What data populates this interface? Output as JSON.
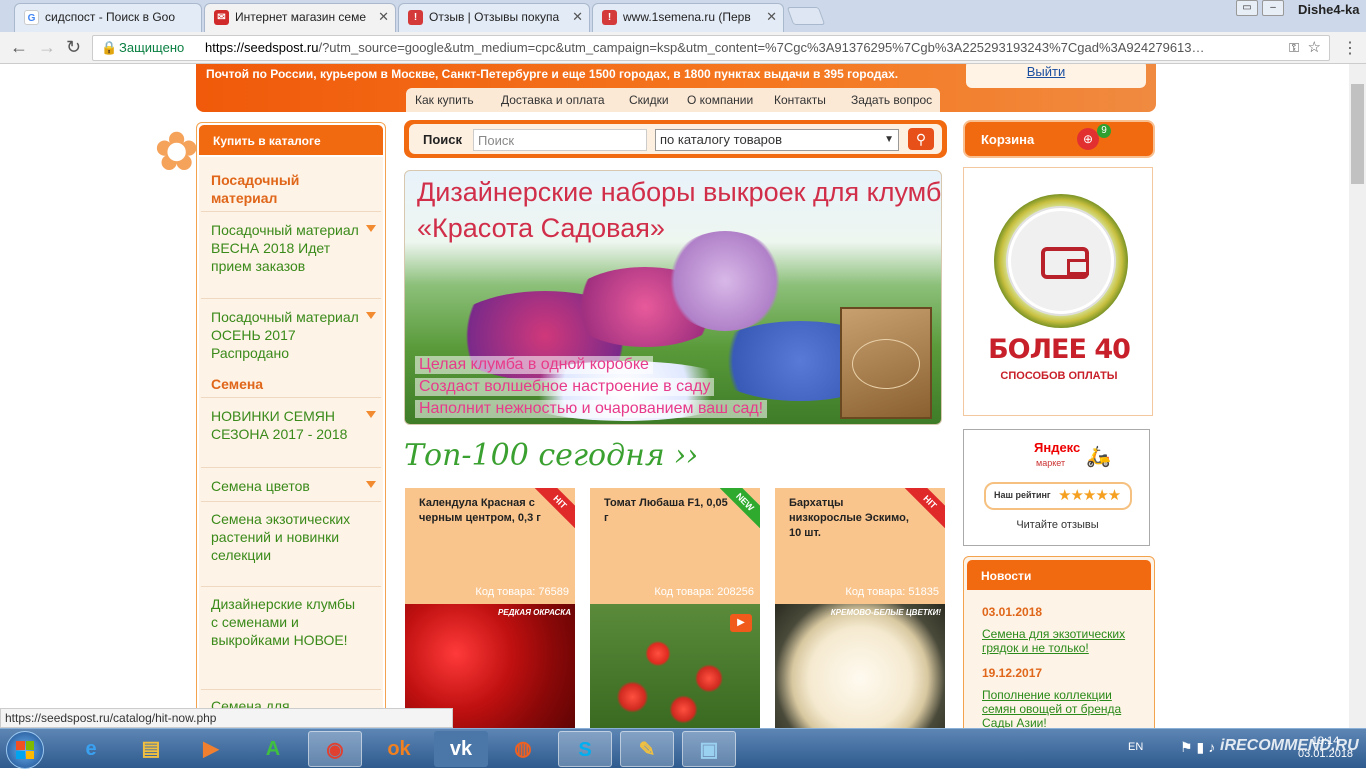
{
  "browser": {
    "tabs": [
      {
        "label": "сидспост - Поиск в Goo",
        "fav_color": "#4285f4",
        "fav": "G"
      },
      {
        "label": "Интернет магазин семе",
        "fav_color": "#d02a2a",
        "fav": "✉"
      },
      {
        "label": "Отзыв | Отзывы покупа",
        "fav_color": "#d43a3a",
        "fav": "!"
      },
      {
        "label": "www.1semena.ru (Перв",
        "fav_color": "#d43a3a",
        "fav": "!"
      }
    ],
    "profile": "Dishe4-ka",
    "secure_label": "Защищено",
    "url_host": "https://seedspost.ru",
    "url_rest": "/?utm_source=google&utm_medium=cpc&utm_campaign=ksp&utm_content=%7Cgc%3A91376295%7Cgb%3A225293193243%7Cgad%3A924279613…",
    "status_url": "https://seedspost.ru/catalog/hit-now.php"
  },
  "site": {
    "delivery_text": "Почтой по России, курьером в Москве, Санкт-Петербурге и еще 1500 городах, в 1800 пунктах выдачи в 395 городах.",
    "logout": "Выйти",
    "nav": [
      "Как купить",
      "Доставка и оплата",
      "Скидки",
      "О компании",
      "Контакты",
      "Задать вопрос"
    ],
    "sidebar": {
      "header": "Купить в каталоге",
      "section1": "Посадочный материал",
      "items1": [
        "Посадочный материал ВЕСНА 2018 Идет прием заказов",
        "Посадочный материал ОСЕНЬ 2017 Распродано"
      ],
      "section2": "Семена",
      "items2": [
        "НОВИНКИ СЕМЯН СЕЗОНА 2017 - 2018",
        "Семена цветов",
        "Семена экзотических растений и новинки селекции",
        "Дизайнерские клумбы с семенами и выкройками НОВОЕ!",
        "Семена для"
      ]
    },
    "search": {
      "label": "Поиск",
      "placeholder": "Поиск",
      "scope": "по каталогу товаров"
    },
    "banner": {
      "title1": "Дизайнерские наборы выкроек для клумб",
      "title2": "«Красота Садовая»",
      "taglines": [
        "Целая клумба в одной коробке",
        "Создаст волшебное настроение в саду",
        "Наполнит нежностью и очарованием ваш сад!"
      ]
    },
    "top100": "Топ-100 сегодня ››",
    "products": [
      {
        "title": "Календула Красная с черным центром, 0,3 г",
        "code": "Код товара: 76589",
        "badge": "HIT",
        "badge_color": "#e02a2a",
        "caption": "РЕДКАЯ ОКРАСКА"
      },
      {
        "title": "Томат Любаша F1, 0,05 г",
        "code": "Код товара: 208256",
        "badge": "NEW",
        "badge_color": "#2faa2f",
        "caption": ""
      },
      {
        "title": "Бархатцы низкорослые Эскимо, 10 шт.",
        "code": "Код товара: 51835",
        "badge": "HIT",
        "badge_color": "#e02a2a",
        "caption": "КРЕМОВО-БЕЛЫЕ ЦВЕТКИ!"
      }
    ],
    "cart": {
      "label": "Корзина",
      "count": "9"
    },
    "payment": {
      "big": "БОЛЕЕ 40",
      "small": "СПОСОБОВ ОПЛАТЫ"
    },
    "yandex": {
      "title": "Яндекс",
      "subtitle": "маркет",
      "rating_label": "Наш рейтинг",
      "stars": "★★★★★",
      "read": "Читайте отзывы"
    },
    "news": {
      "header": "Новости",
      "items": [
        {
          "date": "03.01.2018",
          "text": "Семена для экзотических грядок и не только!"
        },
        {
          "date": "19.12.2017",
          "text": "Пополнение коллекции семян овощей от бренда Сады Азии!"
        }
      ]
    }
  },
  "taskbar": {
    "lang": "EN",
    "time": "19:14",
    "date": "03.01.2018",
    "watermark": "iRECOMMEND.RU"
  }
}
